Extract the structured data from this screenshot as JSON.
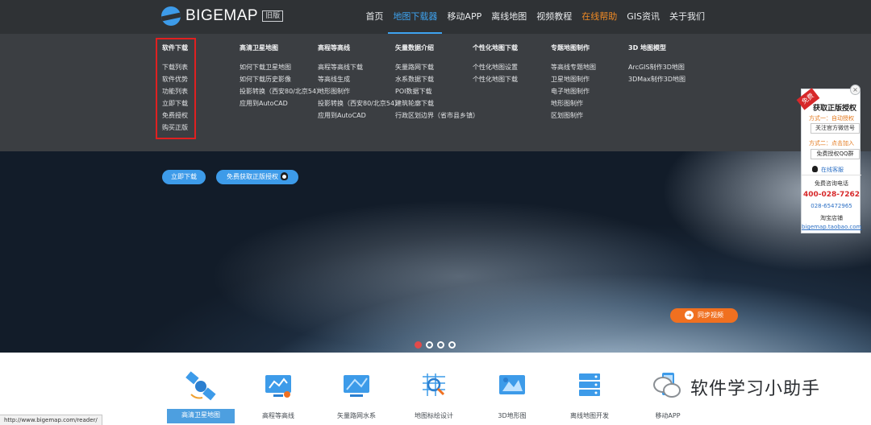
{
  "header": {
    "logo_text": "BIGEMAP",
    "version_badge": "旧版",
    "nav": [
      "首页",
      "地图下载器",
      "移动APP",
      "离线地图",
      "视频教程",
      "在线帮助",
      "GIS资讯",
      "关于我们"
    ],
    "active_nav": "地图下载器",
    "highlight_nav": "在线帮助",
    "active_color": "#3ea3f0",
    "highlight_color": "#f08a24"
  },
  "mega_menu": {
    "columns": [
      {
        "heading": "软件下载",
        "items": [
          "下载列表",
          "软件优势",
          "功能列表",
          "立即下载",
          "免费授权",
          "购买正版"
        ]
      },
      {
        "heading": "高清卫星地图",
        "items": [
          "如何下载卫星地图",
          "如何下载历史影像",
          "投影转换（西安80/北京54）",
          "应用到AutoCAD"
        ]
      },
      {
        "heading": "高程等高线",
        "items": [
          "高程等高线下载",
          "等高线生成",
          "地形图制作",
          "投影转换（西安80/北京54）",
          "应用到AutoCAD"
        ]
      },
      {
        "heading": "矢量数据介绍",
        "items": [
          "矢量路网下载",
          "水系数据下载",
          "POI数据下载",
          "建筑轮廓下载",
          "行政区划边界（省市县乡镇）"
        ]
      },
      {
        "heading": "个性化地图下载",
        "items": [
          "个性化地图设置",
          "个性化地图下载"
        ]
      },
      {
        "heading": "专题地图制作",
        "items": [
          "等高线专题地图",
          "卫星地图制作",
          "电子地图制作",
          "地形图制作",
          "区划图制作"
        ]
      },
      {
        "heading": "3D 地图模型",
        "items": [
          "ArcGIS制作3D地图",
          "3DMax制作3D地图"
        ]
      }
    ],
    "highlight_color": "#e02020"
  },
  "hero": {
    "download_button": "立即下载",
    "license_button": "免费获取正版授权",
    "video_button": "同步视频",
    "slide_dots": 4,
    "active_dot": 0,
    "primary_color": "#3d9be9",
    "video_color": "#f07020"
  },
  "features": [
    {
      "label": "高清卫星地图",
      "icon": "satellite-icon",
      "active": true
    },
    {
      "label": "高程等高线",
      "icon": "contour-monitor-icon",
      "active": false
    },
    {
      "label": "矢量路网水系",
      "icon": "road-network-monitor-icon",
      "active": false
    },
    {
      "label": "地图标绘设计",
      "icon": "map-plotting-icon",
      "active": false
    },
    {
      "label": "3D地形图",
      "icon": "3d-terrain-icon",
      "active": false
    },
    {
      "label": "离线地图开发",
      "icon": "server-stack-icon",
      "active": false
    },
    {
      "label": "移动APP",
      "icon": "mobile-app-icon",
      "active": false
    }
  ],
  "watermark": {
    "text": "软件学习小助手",
    "icon": "wechat-icon"
  },
  "status_bar": {
    "url": "http://www.bigemap.com/reader/"
  },
  "side_widget": {
    "ribbon": "免费",
    "title": "获取正版授权",
    "option1": "方式一：自动授权",
    "option1_box": "关注官方微信号",
    "option2": "方式二：点击加入",
    "option2_box": "免费授权QQ群",
    "service": "在线客服",
    "hotline_label": "免费咨询电话",
    "phone": "400-028-7262",
    "phone2": "028-65472965",
    "shop_label": "淘宝店铺",
    "shop_link": "bigemap.taobao.com",
    "accent": "#d7282a"
  }
}
